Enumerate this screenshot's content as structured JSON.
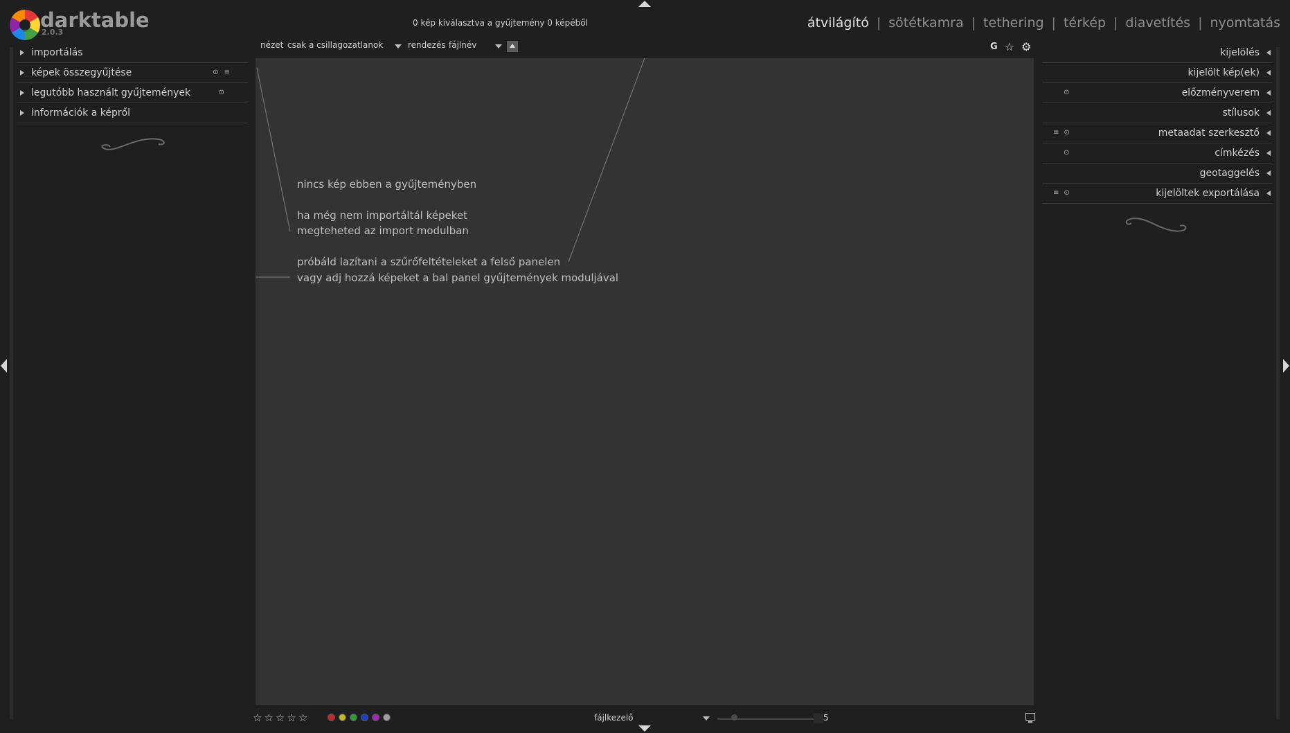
{
  "header": {
    "app_name": "darktable",
    "app_version": "2.0.3",
    "status": "0 kép kiválasztva a gyűjtemény 0 képéből",
    "views": [
      {
        "label": "átvilágító",
        "active": true
      },
      {
        "label": "sötétkamra",
        "active": false
      },
      {
        "label": "tethering",
        "active": false
      },
      {
        "label": "térkép",
        "active": false
      },
      {
        "label": "diavetítés",
        "active": false
      },
      {
        "label": "nyomtatás",
        "active": false
      }
    ],
    "separator": "|"
  },
  "left_panel": {
    "items": [
      {
        "label": "importálás"
      },
      {
        "label": "képek összegyűjtése"
      },
      {
        "label": "legutóbb használt gyűjtemények"
      },
      {
        "label": "információk a képről"
      }
    ]
  },
  "toolbar": {
    "view_label": "nézet",
    "view_value": "csak a csillagozatlanok",
    "sort_label": "rendezés",
    "sort_value": "fájlnév",
    "grouping_icon": "G",
    "star_icon": "☆",
    "gear_icon": "⚙"
  },
  "center": {
    "line1": "nincs kép ebben a gyűjteményben",
    "line2": "ha még nem importáltál képeket",
    "line3": "megteheted az import modulban",
    "line4": "próbáld lazítani a szűrőfeltételeket a felső panelen",
    "line5": "vagy adj hozzá képeket a bal panel gyűjtemények moduljával"
  },
  "right_panel": {
    "items": [
      {
        "label": "kijelölés"
      },
      {
        "label": "kijelölt kép(ek)"
      },
      {
        "label": "előzményverem"
      },
      {
        "label": "stílusok"
      },
      {
        "label": "metaadat szerkesztő"
      },
      {
        "label": "címkézés"
      },
      {
        "label": "geotaggelés"
      },
      {
        "label": "kijelöltek exportálása"
      }
    ]
  },
  "bottom": {
    "stars": [
      "☆",
      "☆",
      "☆",
      "☆",
      "☆"
    ],
    "color_labels": [
      "#c62828",
      "#c0b62a",
      "#2e9e3a",
      "#1e3fc8",
      "#a228b8",
      "#9e9e9e"
    ],
    "layout": "fájlkezelő",
    "zoom": "5"
  }
}
